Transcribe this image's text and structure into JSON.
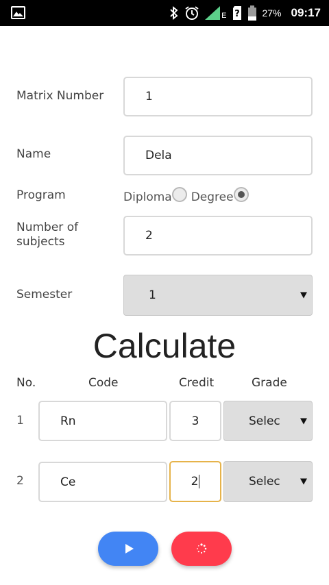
{
  "status_bar": {
    "battery": "27%",
    "time": "09:17",
    "network_letter": "E"
  },
  "form": {
    "matrix_label": "Matrix Number",
    "matrix_value": "1",
    "name_label": "Name",
    "name_value": "Dela",
    "program_label": "Program",
    "program_options": [
      {
        "label": "Diploma",
        "checked": false
      },
      {
        "label": "Degree",
        "checked": true
      }
    ],
    "subjects_label_line1": "Number of",
    "subjects_label_line2": "subjects",
    "subjects_value": "2",
    "semester_label": "Semester",
    "semester_value": "1"
  },
  "heading": "Calculate",
  "table": {
    "headers": {
      "no": "No.",
      "code": "Code",
      "credit": "Credit",
      "grade": "Grade"
    },
    "rows": [
      {
        "no": "1",
        "code": "Rn",
        "credit": "3",
        "grade": "Selec"
      },
      {
        "no": "2",
        "code": "Ce",
        "credit": "2",
        "grade": "Selec"
      }
    ]
  },
  "colors": {
    "play_button": "#4285f4",
    "reset_button": "#ff3b4c",
    "focus_border": "#e6b34a",
    "signal_green": "#5ccf8a"
  }
}
